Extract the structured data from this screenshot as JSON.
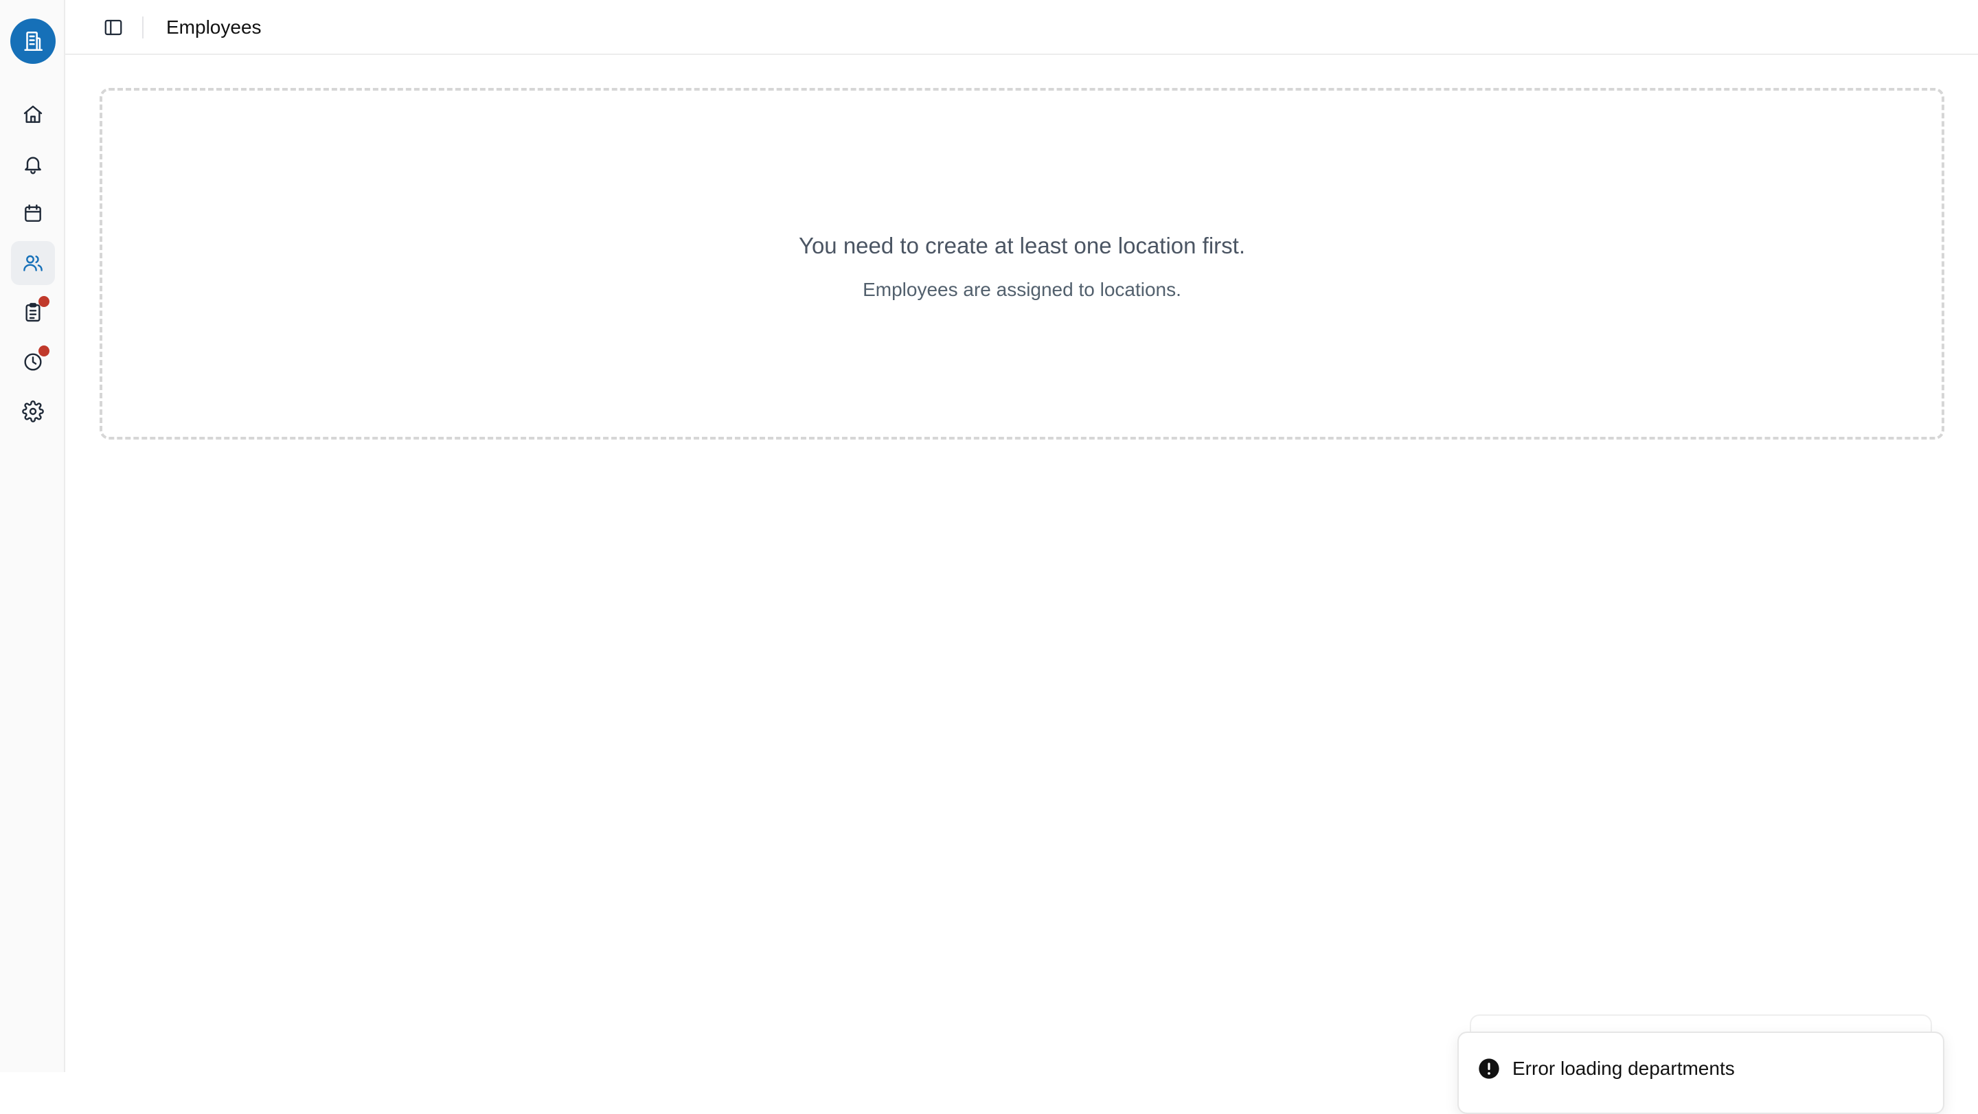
{
  "sidebar": {
    "logo_icon": "building-icon",
    "accent_color": "#1670b8",
    "badge_color": "#c0392b",
    "items": [
      {
        "name": "home",
        "icon": "home-icon",
        "active": false,
        "badge": false
      },
      {
        "name": "notifications",
        "icon": "bell-icon",
        "active": false,
        "badge": false
      },
      {
        "name": "calendar",
        "icon": "calendar-icon",
        "active": false,
        "badge": false
      },
      {
        "name": "employees",
        "icon": "users-icon",
        "active": true,
        "badge": false
      },
      {
        "name": "tasks",
        "icon": "clipboard-list-icon",
        "active": false,
        "badge": true
      },
      {
        "name": "time",
        "icon": "clock-icon",
        "active": false,
        "badge": true
      },
      {
        "name": "settings",
        "icon": "gear-icon",
        "active": false,
        "badge": false
      }
    ]
  },
  "header": {
    "toggle_icon": "sidebar-toggle-icon",
    "title": "Employees"
  },
  "main": {
    "empty_state": {
      "title": "You need to create at least one location first.",
      "subtitle": "Employees are assigned to locations."
    }
  },
  "toast": {
    "icon": "alert-circle-icon",
    "message": "Error loading departments"
  }
}
